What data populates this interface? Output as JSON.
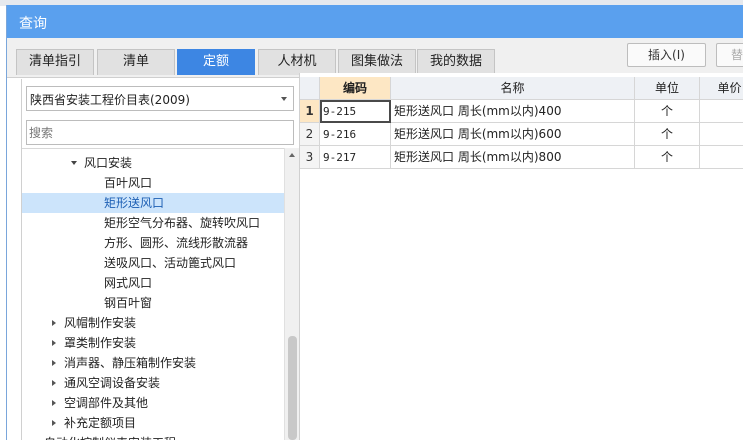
{
  "window": {
    "title": "查询"
  },
  "tabs": [
    {
      "label": "清单指引",
      "active": false
    },
    {
      "label": "清单",
      "active": false
    },
    {
      "label": "定额",
      "active": true
    },
    {
      "label": "人材机",
      "active": false
    },
    {
      "label": "图集做法",
      "active": false
    },
    {
      "label": "我的数据",
      "active": false
    }
  ],
  "toolbar": {
    "insert_label": "插入(I)",
    "replace_label": "替"
  },
  "library": {
    "selected": "陕西省安装工程价目表(2009)"
  },
  "search": {
    "placeholder": "搜索"
  },
  "tree": {
    "items": [
      {
        "label": "风口安装",
        "expand": "down",
        "level": 2,
        "selected": false
      },
      {
        "label": "百叶风口",
        "expand": "none",
        "level": 3,
        "selected": false
      },
      {
        "label": "矩形送风口",
        "expand": "none",
        "level": 3,
        "selected": true
      },
      {
        "label": "矩形空气分布器、旋转吹风口",
        "expand": "none",
        "level": 3,
        "selected": false
      },
      {
        "label": "方形、圆形、流线形散流器",
        "expand": "none",
        "level": 3,
        "selected": false
      },
      {
        "label": "送吸风口、活动篦式风口",
        "expand": "none",
        "level": 3,
        "selected": false
      },
      {
        "label": "网式风口",
        "expand": "none",
        "level": 3,
        "selected": false
      },
      {
        "label": "钢百叶窗",
        "expand": "none",
        "level": 3,
        "selected": false
      },
      {
        "label": "风帽制作安装",
        "expand": "right",
        "level": 1,
        "selected": false
      },
      {
        "label": "罩类制作安装",
        "expand": "right",
        "level": 1,
        "selected": false
      },
      {
        "label": "消声器、静压箱制作安装",
        "expand": "right",
        "level": 1,
        "selected": false
      },
      {
        "label": "通风空调设备安装",
        "expand": "right",
        "level": 1,
        "selected": false
      },
      {
        "label": "空调部件及其他",
        "expand": "right",
        "level": 1,
        "selected": false
      },
      {
        "label": "补充定额项目",
        "expand": "right",
        "level": 1,
        "selected": false
      },
      {
        "label": "自动化控制仪表安装工程",
        "expand": "right",
        "level": 0,
        "selected": false
      }
    ]
  },
  "table": {
    "headers": [
      "编码",
      "名称",
      "单位",
      "单价"
    ],
    "rows": [
      {
        "num": "1",
        "code": "9-215",
        "name": "矩形送风口 周长(mm以内)400",
        "unit": "个"
      },
      {
        "num": "2",
        "code": "9-216",
        "name": "矩形送风口 周长(mm以内)600",
        "unit": "个"
      },
      {
        "num": "3",
        "code": "9-217",
        "name": "矩形送风口 周长(mm以内)800",
        "unit": "个"
      }
    ]
  },
  "colors": {
    "titlebar": "#5aa0ee",
    "active_tab": "#3d86e3",
    "selection": "#cce4fb",
    "header_selected": "#fde7c4"
  }
}
